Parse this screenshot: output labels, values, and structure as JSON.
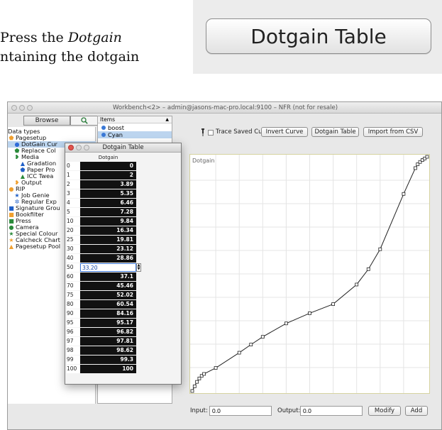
{
  "document": {
    "line1_prefix": "Press the ",
    "line1_italic": "Dotgain",
    "line2": "ntaining the dotgain"
  },
  "callout": {
    "button_label": "Dotgain Table"
  },
  "window": {
    "title": "Workbench<2> – admin@jasons-mac-pro.local:9100 – NFR (not for resale)"
  },
  "sidebar": {
    "browse_tab": "Browse",
    "search_tab_icon": "search-icon",
    "header": "Data types",
    "items": [
      {
        "label": "Pagesetup",
        "icon": "pentagon-icon",
        "color": "#f0a030",
        "indent": 0,
        "selected": false
      },
      {
        "label": "DotGain Cur",
        "icon": "circle-icon",
        "color": "#2f6bd8",
        "indent": 1,
        "selected": true
      },
      {
        "label": "Replace Col",
        "icon": "pentagon-icon",
        "color": "#2a8a3a",
        "indent": 1,
        "selected": false
      },
      {
        "label": "Media",
        "icon": "leaf-icon",
        "color": "#2a8a3a",
        "indent": 1,
        "selected": false
      },
      {
        "label": "Gradation",
        "icon": "triangle-icon",
        "color": "#1f5fc8",
        "indent": 2,
        "selected": false
      },
      {
        "label": "Paper Pro",
        "icon": "pentagon-icon",
        "color": "#1f5fc8",
        "indent": 2,
        "selected": false
      },
      {
        "label": "ICC Twea",
        "icon": "triangle-icon",
        "color": "#2a8a3a",
        "indent": 2,
        "selected": false
      },
      {
        "label": "Output",
        "icon": "leaf-icon",
        "color": "#f0a030",
        "indent": 1,
        "selected": false
      },
      {
        "label": "RIP",
        "icon": "circle-icon",
        "color": "#f0a030",
        "indent": 0,
        "selected": false
      },
      {
        "label": "Job Genie",
        "icon": "star-icon",
        "color": "#1f5fc8",
        "indent": 1,
        "selected": false
      },
      {
        "label": "Regular Exp",
        "icon": "sparkle-icon",
        "color": "#1f5fc8",
        "indent": 1,
        "selected": false
      },
      {
        "label": "Signature Grou",
        "icon": "square-icon",
        "color": "#1f5fc8",
        "indent": 0,
        "selected": false
      },
      {
        "label": "Bookfilter",
        "icon": "square-icon",
        "color": "#f0a030",
        "indent": 0,
        "selected": false
      },
      {
        "label": "Press",
        "icon": "square-icon",
        "color": "#2a8a3a",
        "indent": 0,
        "selected": false
      },
      {
        "label": "Camera",
        "icon": "circle-icon",
        "color": "#2a8a3a",
        "indent": 0,
        "selected": false
      },
      {
        "label": "Special Colour",
        "icon": "star-icon",
        "color": "#2a8a3a",
        "indent": 0,
        "selected": false
      },
      {
        "label": "Calcheck Chart",
        "icon": "star-icon",
        "color": "#f0a030",
        "indent": 0,
        "selected": false
      },
      {
        "label": "Pagesetup Pool",
        "icon": "triangle-icon",
        "color": "#f0a030",
        "indent": 0,
        "selected": false
      }
    ]
  },
  "items_panel": {
    "header": "Items",
    "items": [
      {
        "label": "boost",
        "selected": false
      },
      {
        "label": "Cyan",
        "selected": true
      }
    ]
  },
  "toolbar": {
    "trace_icon": "pin-icon",
    "trace_label": "Trace Saved Curve",
    "trace_checked": false,
    "invert_label": "Invert Curve",
    "dotgain_table_label": "Dotgain Table",
    "import_label": "Import from CSV"
  },
  "graph": {
    "label": "Dotgain"
  },
  "bottom": {
    "input_label": "Input:",
    "input_value": "0.0",
    "output_label": "Output:",
    "output_value": "0.0",
    "modify_label": "Modify",
    "add_label": "Add"
  },
  "dotgain_window": {
    "title": "Dotgain Table",
    "column_header": "Dotgain",
    "rows": [
      {
        "key": "0",
        "value": "0"
      },
      {
        "key": "1",
        "value": "2"
      },
      {
        "key": "2",
        "value": "3.89"
      },
      {
        "key": "3",
        "value": "5.35"
      },
      {
        "key": "4",
        "value": "6.46"
      },
      {
        "key": "5",
        "value": "7.28"
      },
      {
        "key": "10",
        "value": "9.84"
      },
      {
        "key": "20",
        "value": "16.34"
      },
      {
        "key": "25",
        "value": "19.81"
      },
      {
        "key": "30",
        "value": "23.12"
      },
      {
        "key": "40",
        "value": "28.86"
      },
      {
        "key": "50",
        "value": "33.20",
        "editing": true
      },
      {
        "key": "60",
        "value": "37.1"
      },
      {
        "key": "70",
        "value": "45.46"
      },
      {
        "key": "75",
        "value": "52.02"
      },
      {
        "key": "80",
        "value": "60.54"
      },
      {
        "key": "90",
        "value": "84.16"
      },
      {
        "key": "95",
        "value": "95.17"
      },
      {
        "key": "96",
        "value": "96.82"
      },
      {
        "key": "97",
        "value": "97.81"
      },
      {
        "key": "98",
        "value": "98.62"
      },
      {
        "key": "99",
        "value": "99.3"
      },
      {
        "key": "100",
        "value": "100"
      }
    ]
  },
  "colors": {
    "selection": "#bcd5ef",
    "cell_bg": "#111111",
    "graph_border": "#d6d3a0"
  }
}
